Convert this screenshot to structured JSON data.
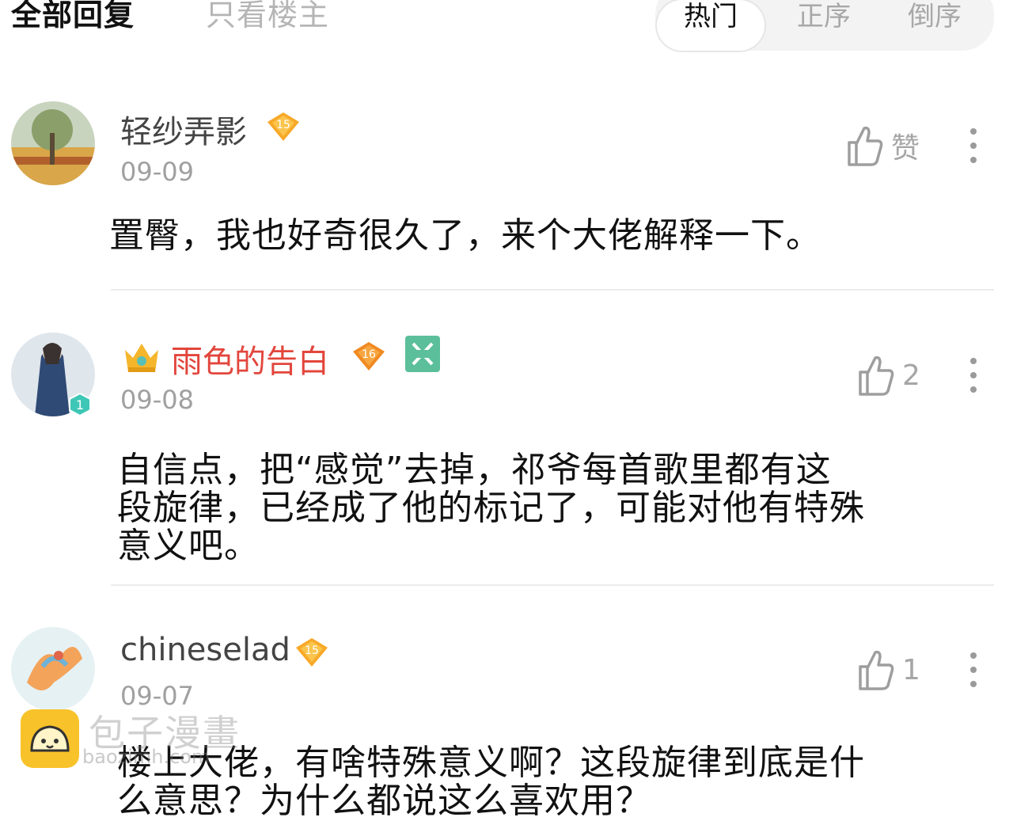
{
  "header": {
    "tab_all": "全部回复",
    "tab_owner": "只看楼主",
    "sort": [
      "热门",
      "正序",
      "倒序"
    ],
    "sort_selected": "热门"
  },
  "comments": [
    {
      "name": "轻纱弄影",
      "level": "15",
      "date": "09-09",
      "like": "赞",
      "text": "置臀，我也好奇很久了，来个大佬解释一下。"
    },
    {
      "name": "雨色的告白",
      "vip_icon": "crown-icon",
      "level": "16",
      "avatar_level": "1",
      "date": "09-08",
      "like": "2",
      "text_lines": [
        "自信点，把“感觉”去掉，祁爷每首歌里都有这",
        "段旋律，已经成了他的标记了，可能对他有特殊",
        "意义吧。"
      ]
    },
    {
      "name": "chineselad",
      "level": "15",
      "date": "09-07",
      "like": "1",
      "text_lines": [
        "楼上大佬，有啥特殊意义啊？这段旋律到底是什",
        "么意思？为什么都说这么喜欢用？"
      ]
    }
  ],
  "watermark": {
    "title": "包子漫畫",
    "url": "baozimh.com"
  },
  "colors": {
    "vip_name": "#e2463c",
    "level_badge": "#f7a928",
    "muted": "#a0a0a0"
  }
}
